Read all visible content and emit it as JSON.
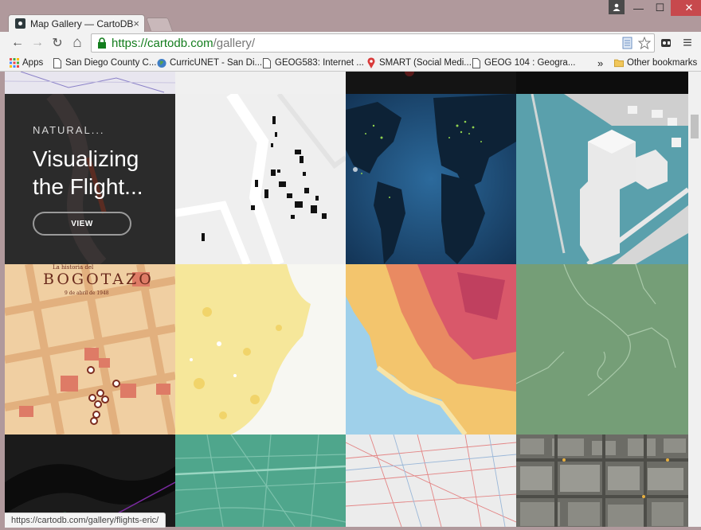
{
  "window": {
    "minimize_glyph": "—",
    "maximize_glyph": "☐",
    "close_glyph": "✕"
  },
  "tab": {
    "title": "Map Gallery — CartoDB",
    "close_glyph": "×"
  },
  "toolbar": {
    "back_glyph": "←",
    "forward_glyph": "→",
    "reload_glyph": "↻",
    "home_glyph": "⌂",
    "menu_glyph": "≡",
    "url_scheme_host": "https://cartodb.com",
    "url_path": "/gallery/"
  },
  "bookmarks": {
    "items": [
      {
        "label": "Apps",
        "icon": "apps-grid-icon"
      },
      {
        "label": "San Diego County C...",
        "icon": "page-icon"
      },
      {
        "label": "CurricUNET - San Di...",
        "icon": "globe-icon"
      },
      {
        "label": "GEOG583: Internet ...",
        "icon": "page-icon"
      },
      {
        "label": "SMART (Social Medi...",
        "icon": "map-pin-icon"
      },
      {
        "label": "GEOG 104 : Geogra...",
        "icon": "page-icon"
      }
    ],
    "overflow_glyph": "»",
    "other_label": "Other bookmarks"
  },
  "feature": {
    "kicker": "NATURAL...",
    "headline": "Visualizing the Flight...",
    "button_label": "VIEW"
  },
  "bogota": {
    "subtitle": "La historia del",
    "title": "BOGOTAZO",
    "date": "9 de abril de 1948"
  },
  "status_url": "https://cartodb.com/gallery/flights-eric/",
  "colors": {
    "accent_green": "#137d1d",
    "frame": "#b0999c",
    "close_red": "#c7494d"
  }
}
